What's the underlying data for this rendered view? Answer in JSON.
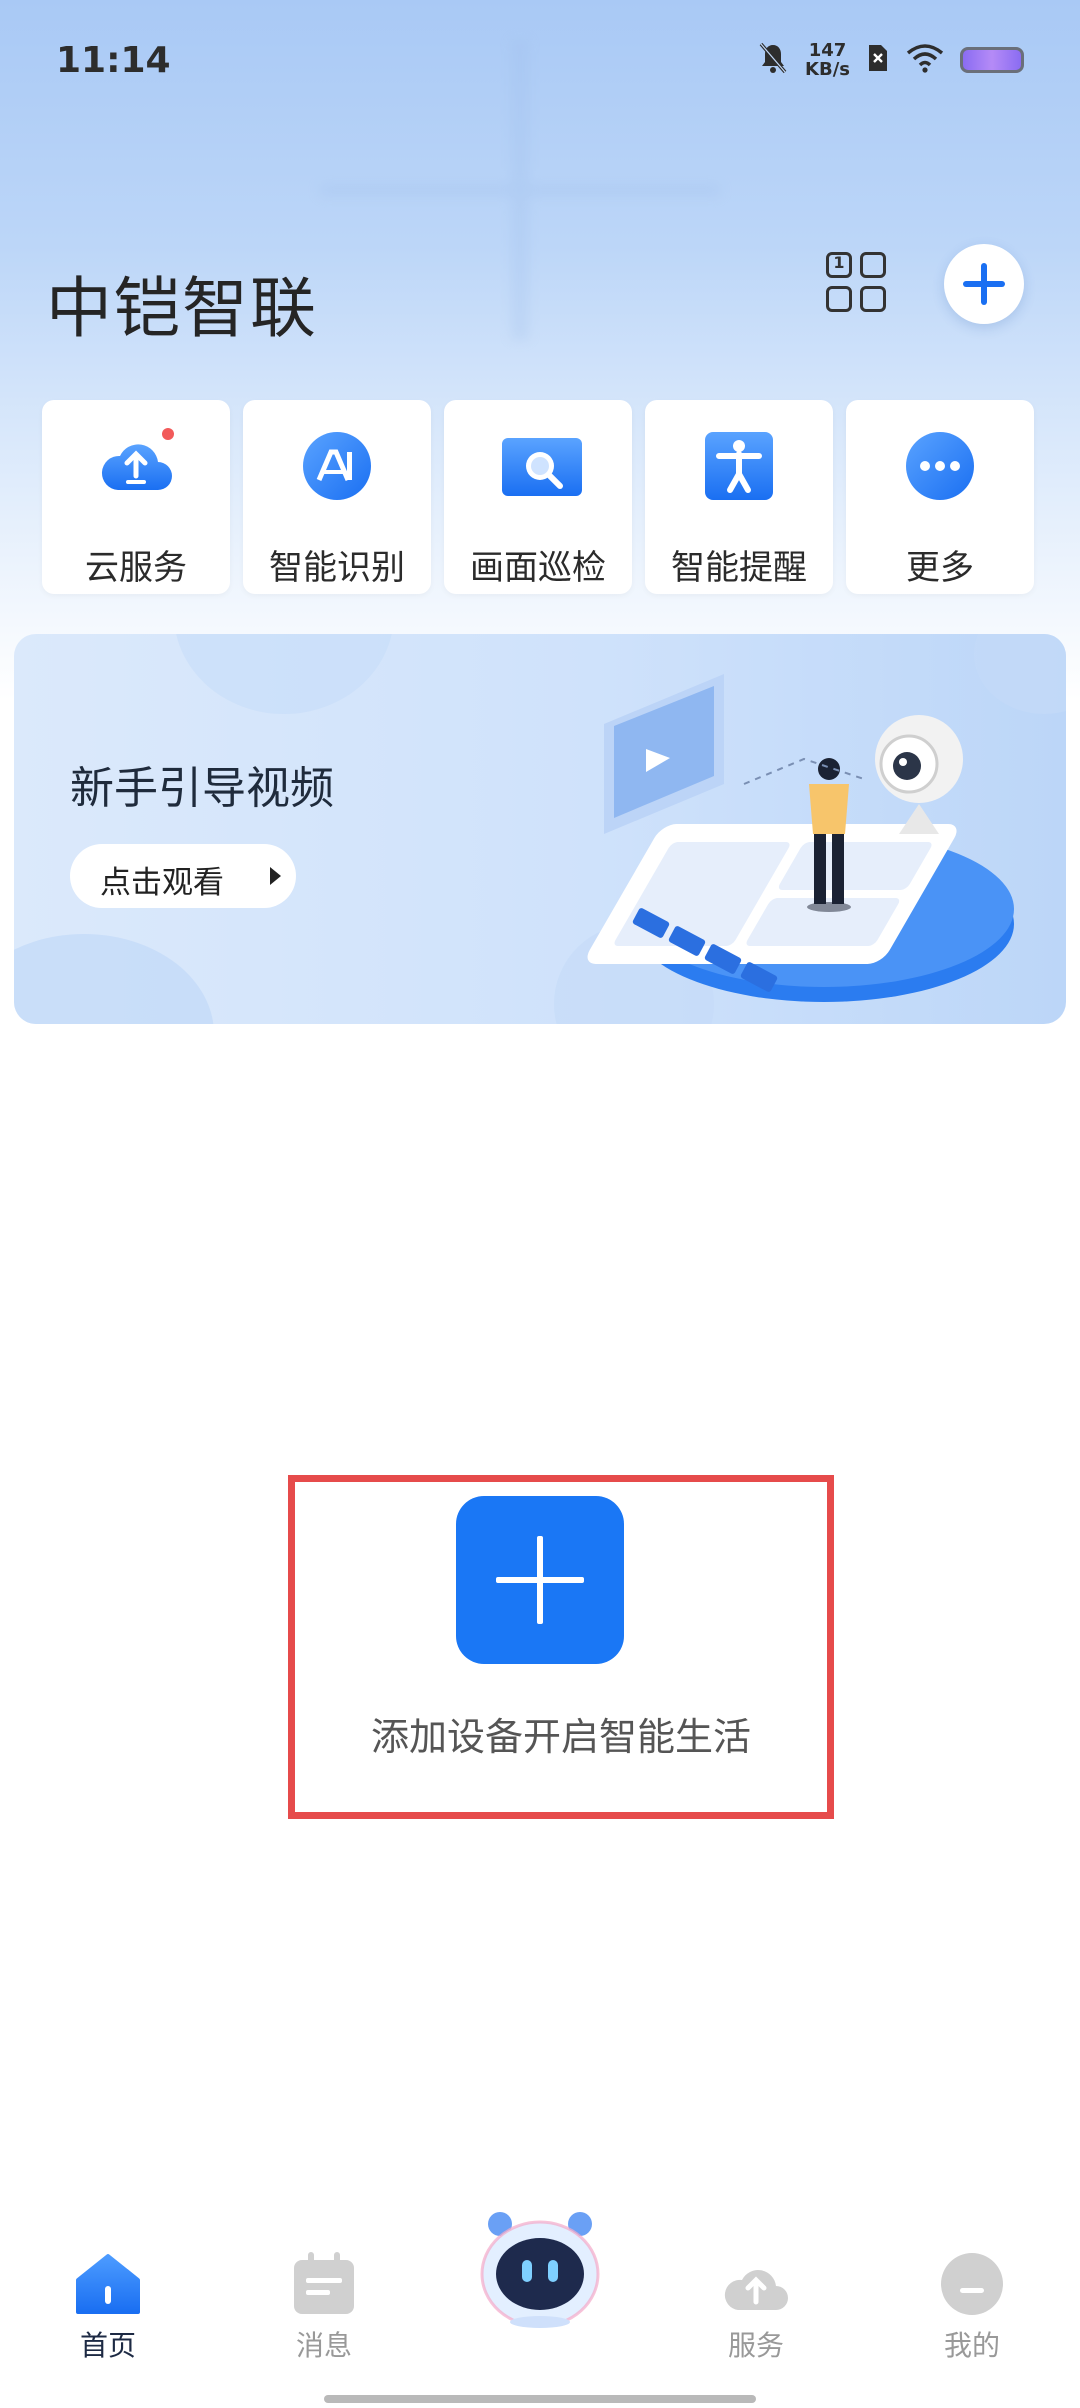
{
  "status_bar": {
    "time": "11:14",
    "net_speed_value": "147",
    "net_speed_unit": "KB/s",
    "icons": [
      "mute-bell-icon",
      "sim-x-icon",
      "wifi-icon",
      "battery-icon"
    ]
  },
  "header": {
    "title": "中铠智联",
    "grid_badge": "1"
  },
  "quick_actions": [
    {
      "label": "云服务",
      "icon": "cloud-upload-icon",
      "has_badge": true
    },
    {
      "label": "智能识别",
      "icon": "ai-recognition-icon"
    },
    {
      "label": "画面巡检",
      "icon": "inspection-magnifier-icon"
    },
    {
      "label": "智能提醒",
      "icon": "person-alert-icon"
    },
    {
      "label": "更多",
      "icon": "more-dots-icon"
    }
  ],
  "banner": {
    "title": "新手引导视频",
    "button_label": "点击观看"
  },
  "empty_state": {
    "label": "添加设备开启智能生活"
  },
  "bottom_nav": [
    {
      "label": "首页",
      "icon": "home-icon",
      "active": true
    },
    {
      "label": "消息",
      "icon": "message-icon",
      "active": false
    },
    {
      "label": "",
      "icon": "robot-assistant-icon",
      "active": false
    },
    {
      "label": "服务",
      "icon": "cloud-service-icon",
      "active": false
    },
    {
      "label": "我的",
      "icon": "profile-icon",
      "active": false
    }
  ],
  "colors": {
    "accent": "#1a77f5",
    "highlight_border": "#e64b4b",
    "badge": "#f25a5a"
  }
}
